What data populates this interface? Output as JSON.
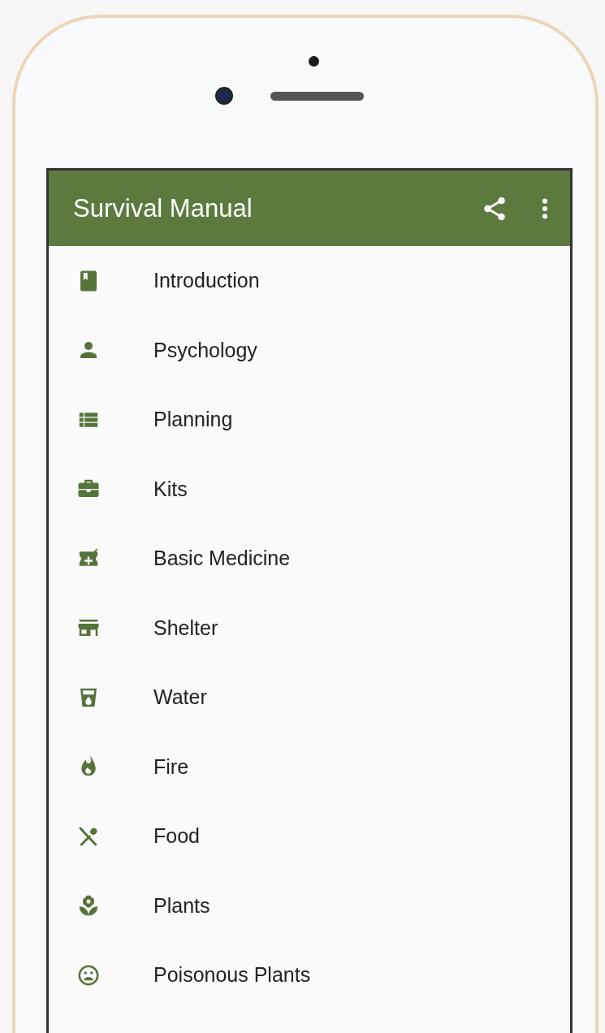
{
  "app_bar": {
    "title": "Survival Manual"
  },
  "menu_items": [
    {
      "kind": "book",
      "label": "Introduction"
    },
    {
      "kind": "person",
      "label": "Psychology"
    },
    {
      "kind": "list",
      "label": "Planning"
    },
    {
      "kind": "briefcase",
      "label": "Kits"
    },
    {
      "kind": "medicine",
      "label": "Basic Medicine"
    },
    {
      "kind": "store",
      "label": "Shelter"
    },
    {
      "kind": "water",
      "label": "Water"
    },
    {
      "kind": "fire",
      "label": "Fire"
    },
    {
      "kind": "food",
      "label": "Food"
    },
    {
      "kind": "flower",
      "label": "Plants"
    },
    {
      "kind": "sad",
      "label": "Poisonous Plants"
    }
  ]
}
